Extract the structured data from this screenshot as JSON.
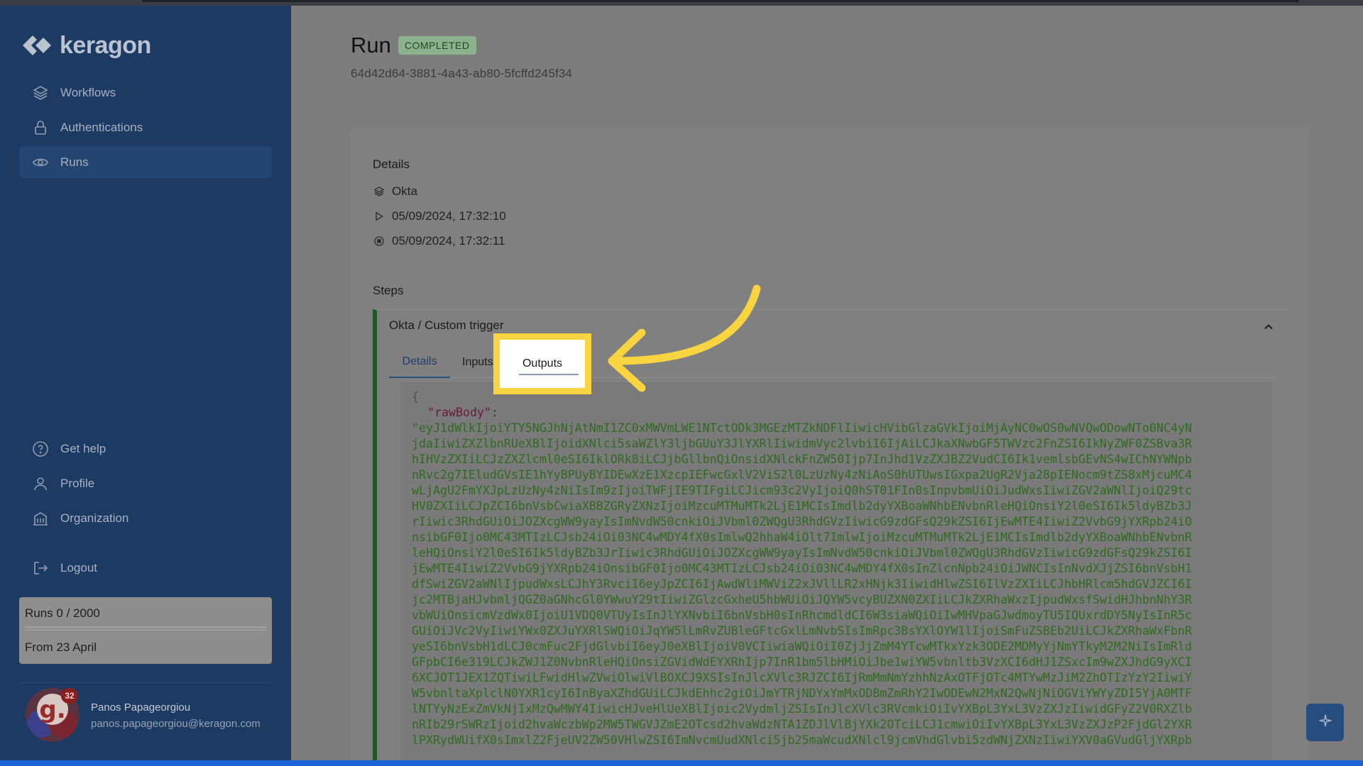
{
  "app": {
    "logo_text": "keragon"
  },
  "sidebar": {
    "items": [
      {
        "label": "Workflows",
        "icon": "layers-icon"
      },
      {
        "label": "Authentications",
        "icon": "lock-icon"
      },
      {
        "label": "Runs",
        "icon": "eye-icon",
        "active": true
      }
    ],
    "bottom_items": [
      {
        "label": "Get help",
        "icon": "help-circle-icon"
      },
      {
        "label": "Profile",
        "icon": "person-icon"
      },
      {
        "label": "Organization",
        "icon": "building-icon"
      }
    ],
    "logout_label": "Logout",
    "usage": {
      "runs_label": "Runs 0 / 2000",
      "runs_used": 0,
      "runs_limit": 2000,
      "period_label": "From 23 April"
    },
    "user": {
      "name": "Panos Papageorgiou",
      "email": "panos.papageorgiou@keragon.com",
      "badge_count": "32",
      "avatar_letter": "g."
    }
  },
  "run": {
    "title": "Run",
    "status": "COMPLETED",
    "id": "64d42d64-3881-4a43-ab80-5fcffd245f34"
  },
  "details": {
    "section_title": "Details",
    "app_name": "Okta",
    "started_at": "05/09/2024, 17:32:10",
    "finished_at": "05/09/2024, 17:32:11"
  },
  "steps": {
    "section_title": "Steps",
    "step_title": "Okta / Custom trigger",
    "tabs": {
      "details": "Details",
      "inputs": "Inputs",
      "outputs": "Outputs"
    },
    "output": {
      "open_brace": "{",
      "key": "\"rawBody\"",
      "colon": ":",
      "lines": [
        "\"eyJ1dWlkIjoiYTY5NGJhNjAtNmI1ZC0xMWVmLWE1NTctODk3MGEzMTZkNDFlIiwicHVibGlzaGVkIjoiMjAyNC0wOS0wNVQwODowNTo0NC4yN",
        "jdaIiwiZXZlbnRUeXBlIjoidXNlci5saWZlY3ljbGUuY3JlYXRlIiwidmVyc2lvbiI6IjAiLCJkaXNwbGF5TWVzc2FnZSI6IkNyZWF0ZSBva3R",
        "hIHVzZXIiLCJzZXZlcml0eSI6IklORk8iLCJjbGllbnQiOnsidXNlckFnZW50Ijp7InJhd1VzZXJBZ2VudCI6Ik1vemlsbGEvNS4wIChNYWNpb",
        "nRvc2g7IEludGVsIE1hYyBPUyBYIDEwXzE1XzcpIEFwcGxlV2ViS2l0LzUzNy4zNiAoS0hUTUwsIGxpa2UgR2Vja28pIENocm9tZS8xMjcuMC4",
        "wLjAgU2FmYXJpLzUzNy4zNiIsIm9zIjoiTWFjIE9TIFgiLCJicm93c2VyIjoiQ0hST01FIn0sInpvbmUiOiJudWxsIiwiZGV2aWNlIjoiQ29tc",
        "HV0ZXIiLCJpZCI6bnVsbCwiaXBBZGRyZXNzIjoiMzcuMTMuMTk2LjE1MCIsImdlb2dyYXBoaWNhbENvbnRleHQiOnsiY2l0eSI6Ik5ldyBZb3J",
        "rIiwic3RhdGUiOiJOZXcgWW9yayIsImNvdW50cnkiOiJVbml0ZWQgU3RhdGVzIiwicG9zdGFsQ29kZSI6IjEwMTE4IiwiZ2VvbG9jYXRpb24iO",
        "nsibGF0Ijo0MC43MTIzLCJsb24iOi03NC4wMDY4fX0sImlwQ2hhaW4iOlt7ImlwIjoiMzcuMTMuMTk2LjE1MCIsImdlb2dyYXBoaWNhbENvbnR",
        "leHQiOnsiY2l0eSI6Ik5ldyBZb3JrIiwic3RhdGUiOiJOZXcgWW9yayIsImNvdW50cnkiOiJVbml0ZWQgU3RhdGVzIiwicG9zdGFsQ29kZSI6I",
        "jEwMTE4IiwiZ2VvbG9jYXRpb24iOnsibGF0Ijo0MC43MTIzLCJsb24iOi03NC4wMDY4fX0sInZlcnNpb24iOiJWNCIsInNvdXJjZSI6bnVsbH1",
        "dfSwiZGV2aWNlIjpudWxsLCJhY3RvciI6eyJpZCI6IjAwdWliMWViZ2xJVllLR2xHNjk3IiwidHlwZSI6IlVzZXIiLCJhbHRlcm5hdGVJZCI6I",
        "jc2MTBjaHJvbmljQGZ0aGNhcGl0YWwuY29tIiwiZGlzcGxheU5hbWUiOiJQYW5vcyBUZXN0ZXIiLCJkZXRhaWxzIjpudWxsfSwidHJhbnNhY3R",
        "vbWUiOnsicmVzdWx0IjoiU1VDQ0VTUyIsInJlYXNvbiI6bnVsbH0sInRhcmdldCI6W3siaWQiOiIwMHVpaGJwdmoyTU5IQUxrdDY5NyIsInR5c",
        "GUiOiJVc2VyIiwiYWx0ZXJuYXRlSWQiOiJqYW5lLmRvZUBleGFtcGxlLmNvbSIsImRpc3BsYXlOYW1lIjoiSmFuZSBEb2UiLCJkZXRhaWxFbnR",
        "yeSI6bnVsbH1dLCJ0cmFuc2FjdGlvbiI6eyJ0eXBlIjoiV0VCIiwiaWQiOiI0ZjJjZmM4YTcwMTkxYzk3ODE2MDMyYjNmYTkyM2M2NiIsImRld",
        "GFpbCI6e319LCJkZWJ1Z0NvbnRleHQiOnsiZGVidWdEYXRhIjp7InR1bm5lbHMiOiJbe1wiYW5vbnltb3VzXCI6dHJ1ZSxcIm9wZXJhdG9yXCI",
        "6XCJOT1JEX1ZQTiwiLFwidHlwZVwiOlwiVlBOXCJ9XSIsInJlcXVlc3RJZCI6IjRmMmNmYzhhNzAxOTFjOTc4MTYwMzJiM2ZhOTIzYzY2IiwiY",
        "W5vbnltaXplclN0YXR1cyI6InByaXZhdGUiLCJkdEhhc2giOiJmYTRjNDYxYmMxODBmZmRhY2IwODEwN2MxN2QwNjNiOGViYWYyZDI5YjA0MTF",
        "lNTYyNzExZmVkNjIxMzQwMWY4IiwicHJveHlUeXBlIjoic2VydmljZSIsInJlcXVlc3RVcmkiOiIvYXBpL3YxL3VzZXJzIiwidGFyZ2V0RXZlb",
        "nRIb29rSWRzIjoid2hvaWczbWp2MW5TWGVJZmE2OTcsd2hvaWdzNTA1ZDJlVlBjYXk2OTciLCJ1cmwiOiIvYXBpL3YxL3VzZXJzP2FjdGl2YXR",
        "lPXRydWUifX0sImxlZ2FjeUV2ZW50VHlwZSI6ImNvcmUudXNlci5jb25maWcudXNlcl9jcmVhdGlvbi5zdWNjZXNzIiwiYXV0aGVudGljYXRpb"
      ]
    }
  },
  "icons": {
    "floating_action": "sparkle-icon",
    "expand": "chevron-up-icon"
  },
  "colors": {
    "sidebar": "#1d3a63",
    "status_badge": "#8db08e",
    "highlight": "#f7d440",
    "arrow": "#f7d440",
    "step_border": "#1d5a26"
  }
}
